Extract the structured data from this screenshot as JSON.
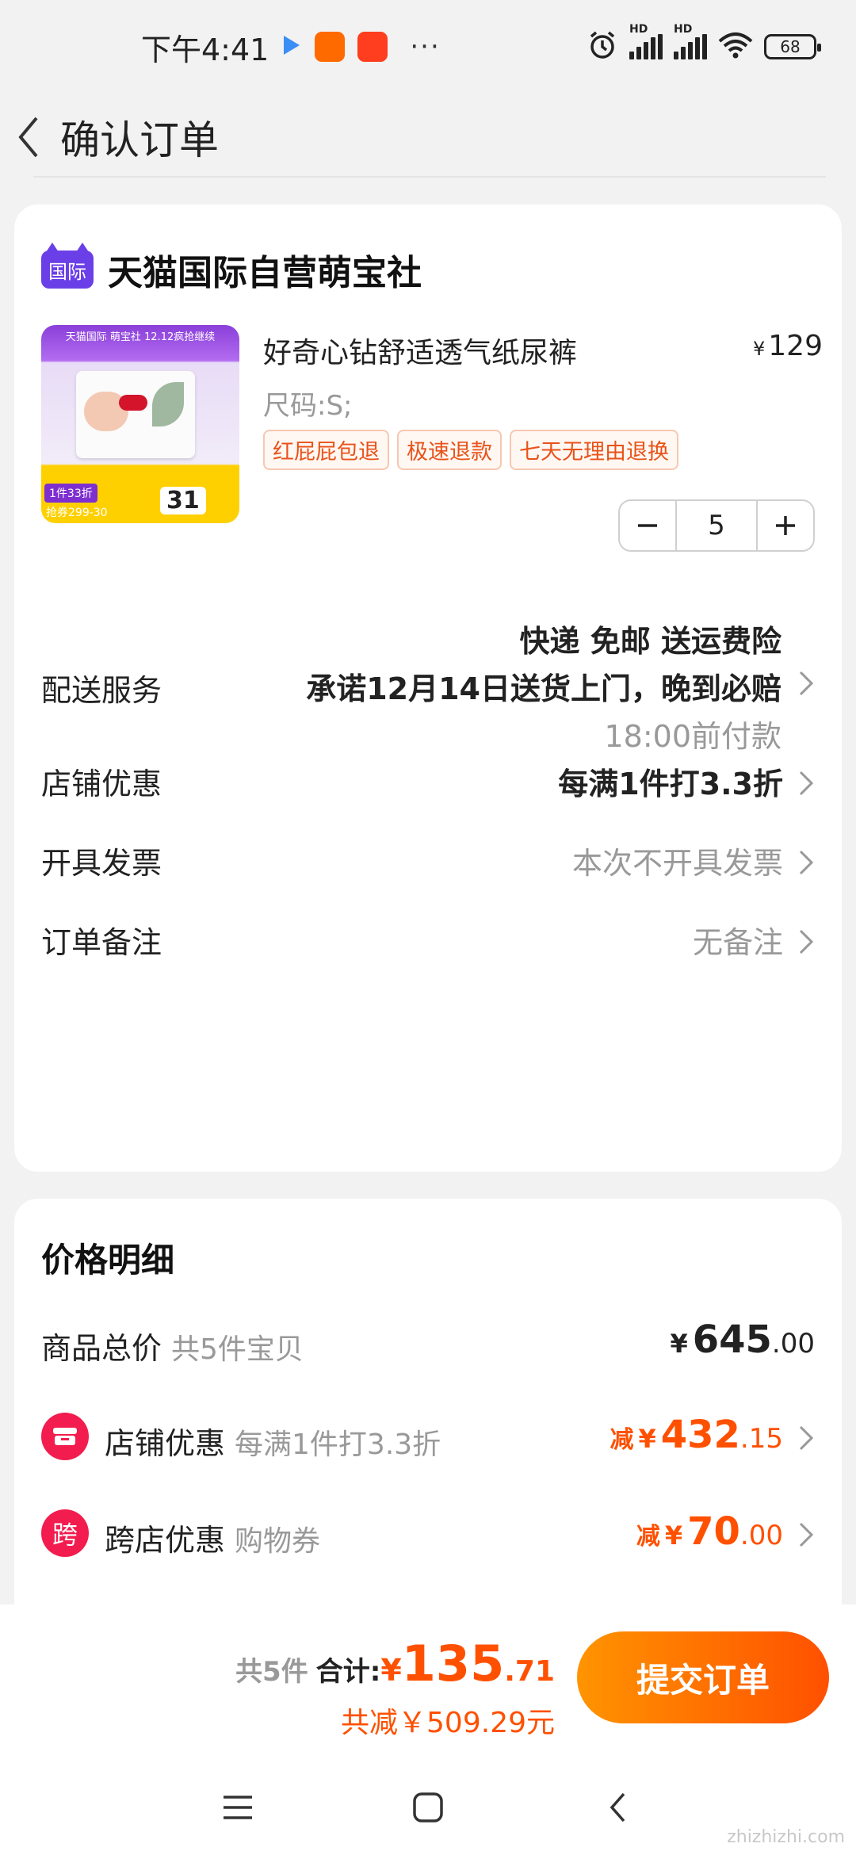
{
  "status_bar": {
    "time": "下午4:41",
    "more": "···",
    "battery": "68",
    "network_label": "HD"
  },
  "header": {
    "title": "确认订单"
  },
  "order": {
    "shop_badge": "国际",
    "shop_name": "天猫国际自营萌宝社",
    "product": {
      "name": "好奇心钻舒适透气纸尿裤",
      "currency": "¥",
      "price": "129",
      "sku": "尺码:S;",
      "tags": [
        "红屁屁包退",
        "极速退款",
        "七天无理由退换"
      ],
      "quantity": "5",
      "image": {
        "top_text": "天猫国际 萌宝社 12.12疯抢继续",
        "tag_text": "1件33折",
        "coupon_text": "抢券299-30",
        "price_text": "31"
      }
    },
    "delivery": {
      "label": "配送服务",
      "line1": "快递 免邮 送运费险",
      "line2": "承诺12月14日送货上门，晚到必赔",
      "line3": "18:00前付款"
    },
    "discount": {
      "label": "店铺优惠",
      "value": "每满1件打3.3折"
    },
    "invoice": {
      "label": "开具发票",
      "value": "本次不开具发票"
    },
    "note": {
      "label": "订单备注",
      "value": "无备注"
    }
  },
  "price_detail": {
    "title": "价格明细",
    "total": {
      "label": "商品总价",
      "sub": "共5件宝贝",
      "currency": "¥",
      "amount_int": "645",
      "amount_dec": ".00"
    },
    "shop_discount": {
      "badge": "",
      "label": "店铺优惠",
      "sub": "每满1件打3.3折",
      "prefix": "减",
      "currency": "¥",
      "amount_int": "432",
      "amount_dec": ".15"
    },
    "cross_discount": {
      "badge": "跨",
      "label": "跨店优惠",
      "sub": "购物券",
      "prefix": "减",
      "currency": "¥",
      "amount_int": "70",
      "amount_dec": ".00"
    }
  },
  "bottom_bar": {
    "count": "共5件",
    "total_label": "合计:",
    "currency": "¥",
    "total_int": "135",
    "total_dec": ".71",
    "saved": "共减￥509.29元",
    "submit_label": "提交订单"
  },
  "watermark": "zhizhizhi.com",
  "colors": {
    "accent": "#ff5000",
    "accent_gradient_start": "#ff9400",
    "shop_badge": "#6b3fe7",
    "discount_badge": "#f21c4e"
  },
  "icons": {
    "back": "chevron-left-icon",
    "row_arrow": "chevron-right-icon",
    "nav_menu": "menu-icon",
    "nav_home": "home-square-icon",
    "nav_back": "back-arrow-icon"
  }
}
